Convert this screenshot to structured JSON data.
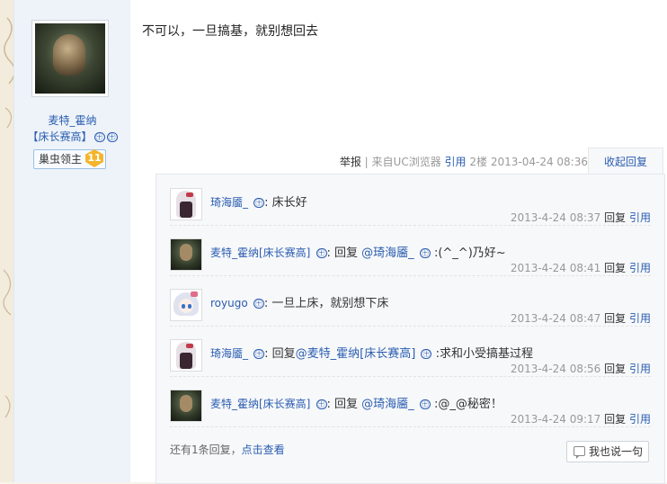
{
  "post": {
    "author_name": "麦特_霍纳",
    "author_title": "【床长赛高】",
    "vip": "㊉",
    "badge_label": "巢虫领主",
    "badge_level": "11",
    "content": "不可以，一旦搞基，就别想回去",
    "meta": {
      "report": "举报",
      "sep": "|",
      "source": "来自UC浏览器",
      "quote": "引用",
      "floor": "2楼",
      "time": "2013-04-24 08:36",
      "collapse": "收起回复"
    }
  },
  "replies": [
    {
      "name": "琦海靥_",
      "vip": "㊉",
      "parts": [
        ": 床长好"
      ],
      "time": "2013-4-24 08:37",
      "reply": "回复",
      "quote": "引用",
      "avatar": "girl-avatar"
    },
    {
      "name": "麦特_霍纳[床长赛高]",
      "vip": "㊉",
      "pre": ": 回复 ",
      "mention": "@琦海靥_",
      "mention_vip": "㊉",
      "post": " :(^_^)乃好~",
      "time": "2013-4-24 08:41",
      "reply": "回复",
      "quote": "引用",
      "avatar": "man-avatar"
    },
    {
      "name": "royugo",
      "vip": "㊉",
      "pre": ": 一旦上床，就别想下床",
      "time": "2013-4-24 08:47",
      "reply": "回复",
      "quote": "引用",
      "avatar": "anime-avatar"
    },
    {
      "name": "琦海靥_",
      "vip": "㊉",
      "pre": ": 回复",
      "mention": "@麦特_霍纳[床长赛高]",
      "mention_vip": "㊉",
      "post": " :求和小受搞基过程",
      "time": "2013-4-24 08:56",
      "reply": "回复",
      "quote": "引用",
      "avatar": "girl-avatar"
    },
    {
      "name": "麦特_霍纳[床长赛高]",
      "vip": "㊉",
      "pre": ": 回复 ",
      "mention": "@琦海靥_",
      "mention_vip": "㊉",
      "post": " :@_@秘密！",
      "time": "2013-4-24 09:17",
      "reply": "回复",
      "quote": "引用",
      "avatar": "man-avatar"
    }
  ],
  "footer": {
    "more_text": "还有1条回复，",
    "more_link": "点击查看",
    "say_button": "我也说一句"
  },
  "colors": {
    "link": "#2a5db0",
    "badge_level": "#f5b52b"
  }
}
